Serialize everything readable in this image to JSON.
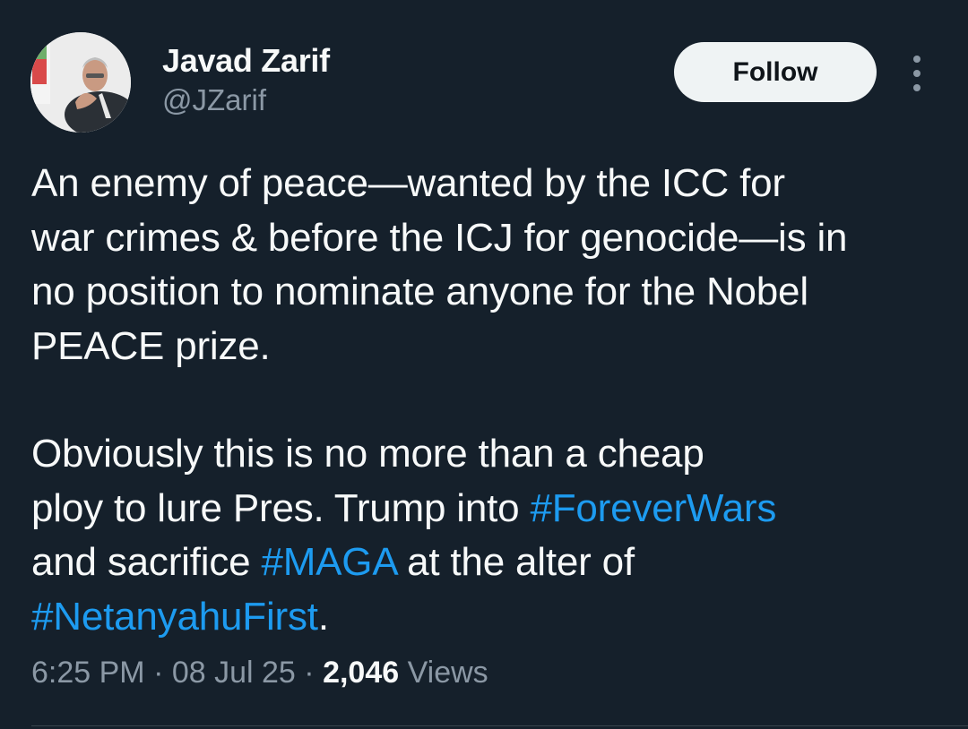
{
  "author": {
    "name": "Javad Zarif",
    "handle": "@JZarif",
    "avatar_icon": "profile-photo"
  },
  "follow_label": "Follow",
  "more_icon": "more-options-icon",
  "tweet": {
    "p1_lines": [
      "An enemy of peace—wanted by the ICC for",
      "war crimes & before the ICJ for genocide—is in",
      "no position to nominate anyone for the Nobel",
      "PEACE prize."
    ],
    "p2": {
      "line1": "Obviously this is no more than a cheap",
      "line2_text": "ploy to lure Pres. Trump into ",
      "hashtag1": "#ForeverWars",
      "line3_text": "and sacrifice ",
      "hashtag2": "#MAGA",
      "line3_tail": " at the alter of",
      "hashtag3": "#NetanyahuFirst",
      "end": "."
    }
  },
  "meta": {
    "time": "6:25 PM",
    "sep1": " · ",
    "date": "08 Jul 25",
    "sep2": " · ",
    "views_count": "2,046",
    "views_label": " Views"
  },
  "colors": {
    "background": "#15202b",
    "hashtag": "#1d9bf0",
    "secondary_text": "#8b98a5"
  }
}
